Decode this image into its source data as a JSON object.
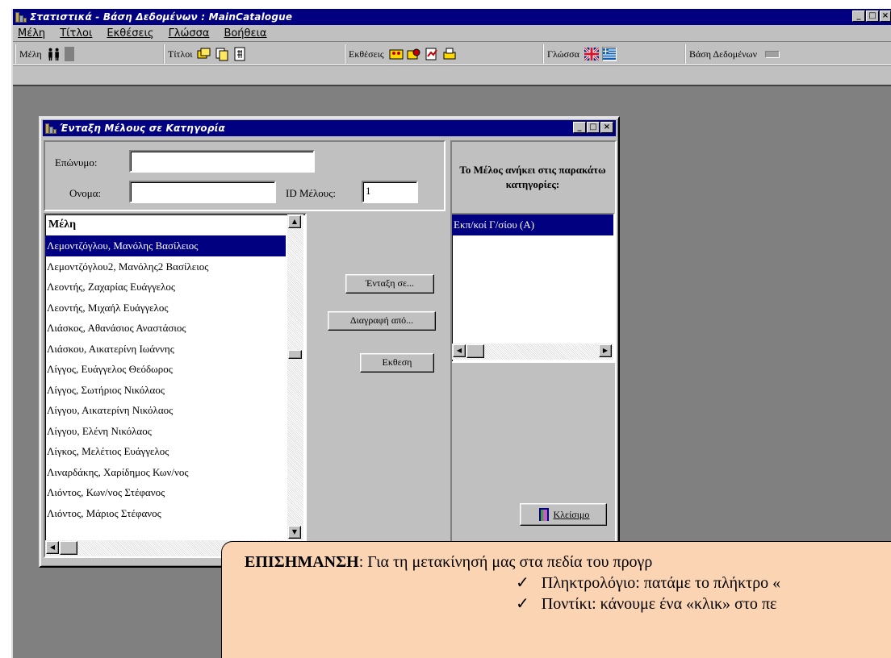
{
  "main_window": {
    "title": "Στατιστικά - Βάση Δεδομένων : MainCatalogue",
    "controls": {
      "minimize": "_",
      "maximize": "□",
      "close": "×"
    }
  },
  "menu": {
    "items": [
      {
        "label": "Μέλη"
      },
      {
        "label": "Τίτλοι"
      },
      {
        "label": "Εκθέσεις"
      },
      {
        "label": "Γλώσσα"
      },
      {
        "label": "Βοήθεια"
      }
    ]
  },
  "toolbar": {
    "members_label": "Μέλη",
    "titles_label": "Τίτλοι",
    "reports_label": "Εκθέσεις",
    "language_label": "Γλώσσα",
    "database_label": "Βάση Δεδομένων"
  },
  "dialog": {
    "title": "Ένταξη Μέλους σε Κατηγορία",
    "surname_label": "Επώνυμο:",
    "surname_value": "",
    "name_label": "Ονομα:",
    "name_value": "",
    "id_label": "ID Μέλους:",
    "id_value": "1",
    "members_header": "Μέλη",
    "members": [
      "Λεμοντζόγλου, Μανόλης Βασίλειος",
      "Λεμοντζόγλου2, Μανόλης2 Βασίλειος",
      "Λεοντής, Ζαχαρίας Ευάγγελος",
      "Λεοντής, Μιχαήλ Ευάγγελος",
      "Λιάσκος, Αθανάσιος Αναστάσιος",
      "Λιάσκου, Αικατερίνη Ιωάννης",
      "Λίγγος, Ευάγγελος Θεόδωρος",
      "Λίγγος, Σωτήριος Νικόλαος",
      "Λίγγου, Αικατερίνη Νικόλαος",
      "Λίγγου, Ελένη Νικόλαος",
      "Λίγκος, Μελέτιος Ευάγγελος",
      "Λιναρδάκης, Χαρίδημος Κων/νος",
      "Λιόντος, Κων/νος Στέφανος",
      "Λιόντος, Μάριος Στέφανος"
    ],
    "selected_member_index": 0,
    "btn_include": "Ένταξη σε...",
    "btn_delete": "Διαγραφή από...",
    "btn_report": "Εκθεση",
    "categories_header": "Το Μέλος ανήκει στις παρακάτω κατηγορίες:",
    "categories": [
      "Εκπ/κοί Γ/σίου (Α)"
    ],
    "btn_close": "Κλείσιμο"
  },
  "note": {
    "lead": "ΕΠΙΣΗΜΑΝΣΗ",
    "text": ": Για τη μετακίνησή μας στα πεδία του προγρ",
    "bullets": [
      "Πληκτρολόγιο: πατάμε το πλήκτρο «",
      "Ποντίκι: κάνουμε ένα «κλικ» στο πε"
    ],
    "bullet_glyph": "✓",
    "bg_color": "#fbd4b4"
  }
}
